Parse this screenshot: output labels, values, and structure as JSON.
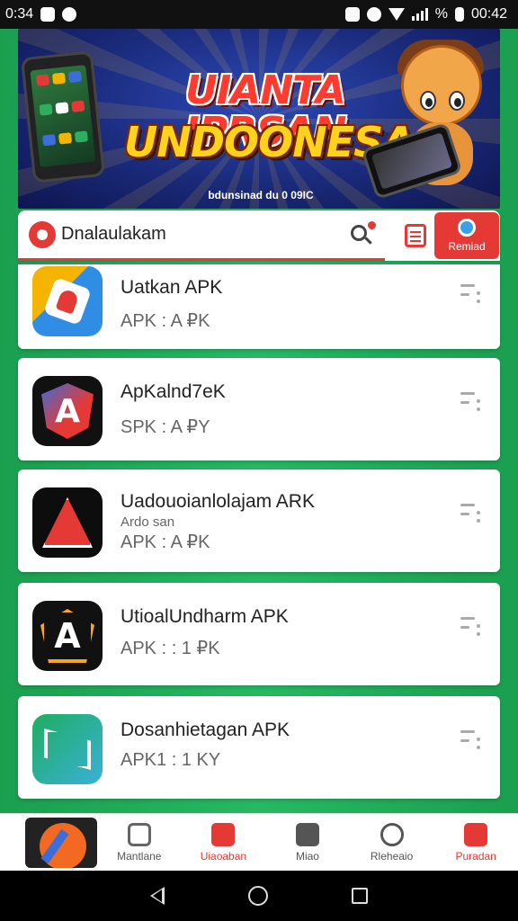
{
  "status_bar": {
    "time_left": "0:34",
    "time_right": "00:42",
    "battery": "%"
  },
  "banner": {
    "title_line1": "UIANTA IPRSAN",
    "title_line2": "UNDOONESA",
    "subtitle": "bdunsinad du 0 09IC",
    "dots_count": 3
  },
  "topbar": {
    "active_tab": "Dnalaulakam",
    "recent_button": "Remiad"
  },
  "apps": [
    {
      "name": "Uatkan APK",
      "extra": "",
      "meta": "APK : A ₽K",
      "icon_colors": [
        "#f5b400",
        "#2f8de4",
        "#e53935"
      ]
    },
    {
      "name": "ApKalnd7eK",
      "extra": "",
      "meta": "SPK : A ₽Y",
      "icon_colors": [
        "#222222",
        "#e53935",
        "#3d6dd8"
      ]
    },
    {
      "name": "Uadouoianlolajam ARK",
      "extra": "Ardo san",
      "meta": "APK : A ₽K",
      "icon_colors": [
        "#111111",
        "#e53935",
        "#ffffff"
      ]
    },
    {
      "name": "UtioalUndharm APK",
      "extra": "",
      "meta": "APK : : 1 ₽K",
      "icon_colors": [
        "#111111",
        "#f5a524",
        "#ffffff"
      ]
    },
    {
      "name": "Dosanhietagan APK",
      "extra": "",
      "meta": "APK1 : 1 KY",
      "icon_colors": [
        "#1fae5f",
        "#3ab0d8",
        "#ffffff"
      ]
    }
  ],
  "bottom_nav": [
    {
      "label": "Mantlane",
      "icon": "edit-icon",
      "active": false
    },
    {
      "label": "Uiaoaban",
      "icon": "apps-icon",
      "active": true
    },
    {
      "label": "Miao",
      "icon": "games-icon",
      "active": false
    },
    {
      "label": "Rleheaio",
      "icon": "notification-icon",
      "active": false
    },
    {
      "label": "Puradan",
      "icon": "download-icon",
      "active": true
    }
  ],
  "colors": {
    "accent": "#e53935",
    "frame": "#1faa55",
    "banner_bg": "#1a2a7a"
  }
}
